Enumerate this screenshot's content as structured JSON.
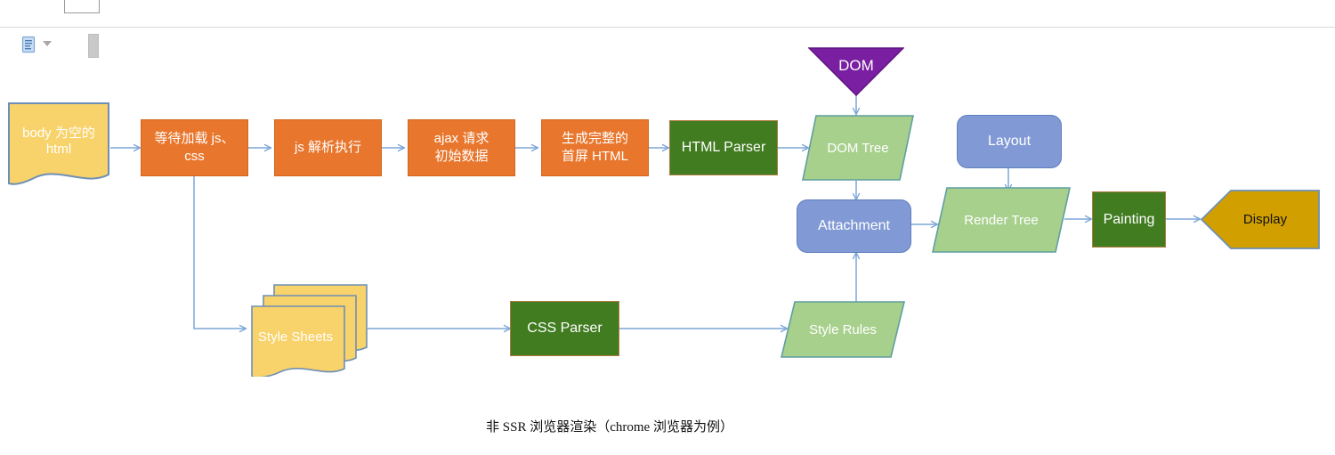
{
  "document": {
    "caption": "非 SSR 浏览器渲染（chrome 浏览器为例）"
  },
  "toolbar": {
    "paste_icon": "paste-document-icon",
    "caret_icon": "chevron-down-icon",
    "scroll_marker": "scrollbar-thumb"
  },
  "colors": {
    "orange": "#E8762C",
    "gold": "#F8D26A",
    "dark_green": "#417C21",
    "light_green": "#A8D08D",
    "blue": "#8199D4",
    "purple": "#7B1FA2",
    "display_gold": "#D1A000",
    "connector": "#7CA6D8"
  },
  "flow": {
    "nodes": [
      {
        "id": "body-html",
        "label": "body 为空的\nhtml",
        "shape": "document",
        "fill": "#F8D26A"
      },
      {
        "id": "wait-js-css",
        "label": "等待加载 js、\ncss",
        "shape": "rect",
        "fill": "#E8762C"
      },
      {
        "id": "js-parse",
        "label": "js 解析执行",
        "shape": "rect",
        "fill": "#E8762C"
      },
      {
        "id": "ajax-request",
        "label": "ajax 请求\n初始数据",
        "shape": "rect",
        "fill": "#E8762C"
      },
      {
        "id": "gen-html",
        "label": "生成完整的\n首屏 HTML",
        "shape": "rect",
        "fill": "#E8762C"
      },
      {
        "id": "html-parser",
        "label": "HTML Parser",
        "shape": "rect",
        "fill": "#417C21"
      },
      {
        "id": "dom",
        "label": "DOM",
        "shape": "triangle-down",
        "fill": "#7B1FA2"
      },
      {
        "id": "dom-tree",
        "label": "DOM Tree",
        "shape": "parallelogram",
        "fill": "#A8D08D"
      },
      {
        "id": "attachment",
        "label": "Attachment",
        "shape": "rounded-rect",
        "fill": "#8199D4"
      },
      {
        "id": "layout",
        "label": "Layout",
        "shape": "rounded-rect",
        "fill": "#8199D4"
      },
      {
        "id": "render-tree",
        "label": "Render Tree",
        "shape": "parallelogram",
        "fill": "#A8D08D"
      },
      {
        "id": "painting",
        "label": "Painting",
        "shape": "rect",
        "fill": "#417C21"
      },
      {
        "id": "display",
        "label": "Display",
        "shape": "pentagon-left",
        "fill": "#D1A000"
      },
      {
        "id": "style-sheets",
        "label": "Style Sheets",
        "shape": "multi-document",
        "fill": "#F8D26A"
      },
      {
        "id": "css-parser",
        "label": "CSS Parser",
        "shape": "rect",
        "fill": "#417C21"
      },
      {
        "id": "style-rules",
        "label": "Style Rules",
        "shape": "parallelogram",
        "fill": "#A8D08D"
      }
    ]
  }
}
